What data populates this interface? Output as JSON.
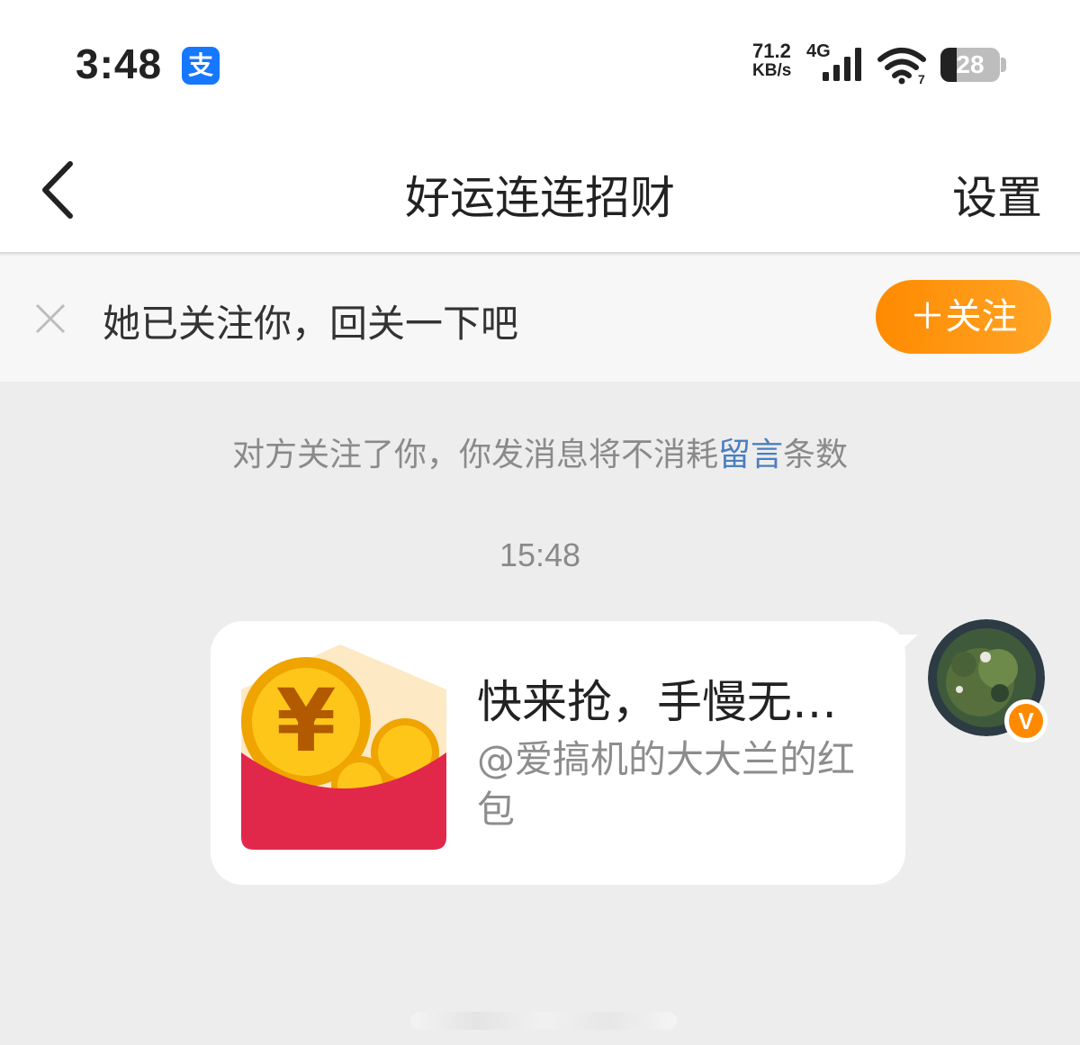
{
  "status_bar": {
    "time": "3:48",
    "app_badge": "支",
    "net_speed_value": "71.2",
    "net_speed_unit": "KB/s",
    "network_type": "4G",
    "battery_level": "28",
    "accent_color": "#1677ff"
  },
  "navbar": {
    "title": "好运连连招财",
    "settings_label": "设置",
    "back_icon": "chevron-left-icon"
  },
  "follow_bar": {
    "text": "她已关注你，回关一下吧",
    "button_label": "＋关注",
    "close_icon": "close-icon",
    "button_color": "#ff8a00"
  },
  "chat": {
    "notice_before": "对方关注了你，你发消息将不消耗",
    "notice_link": "留言",
    "notice_after": "条数",
    "timestamp": "15:48",
    "message": {
      "title": "快来抢，手慢无…",
      "subtitle": "@爱搞机的大大兰的红包",
      "icon": "red-packet-icon",
      "avatar_badge": "V"
    }
  }
}
